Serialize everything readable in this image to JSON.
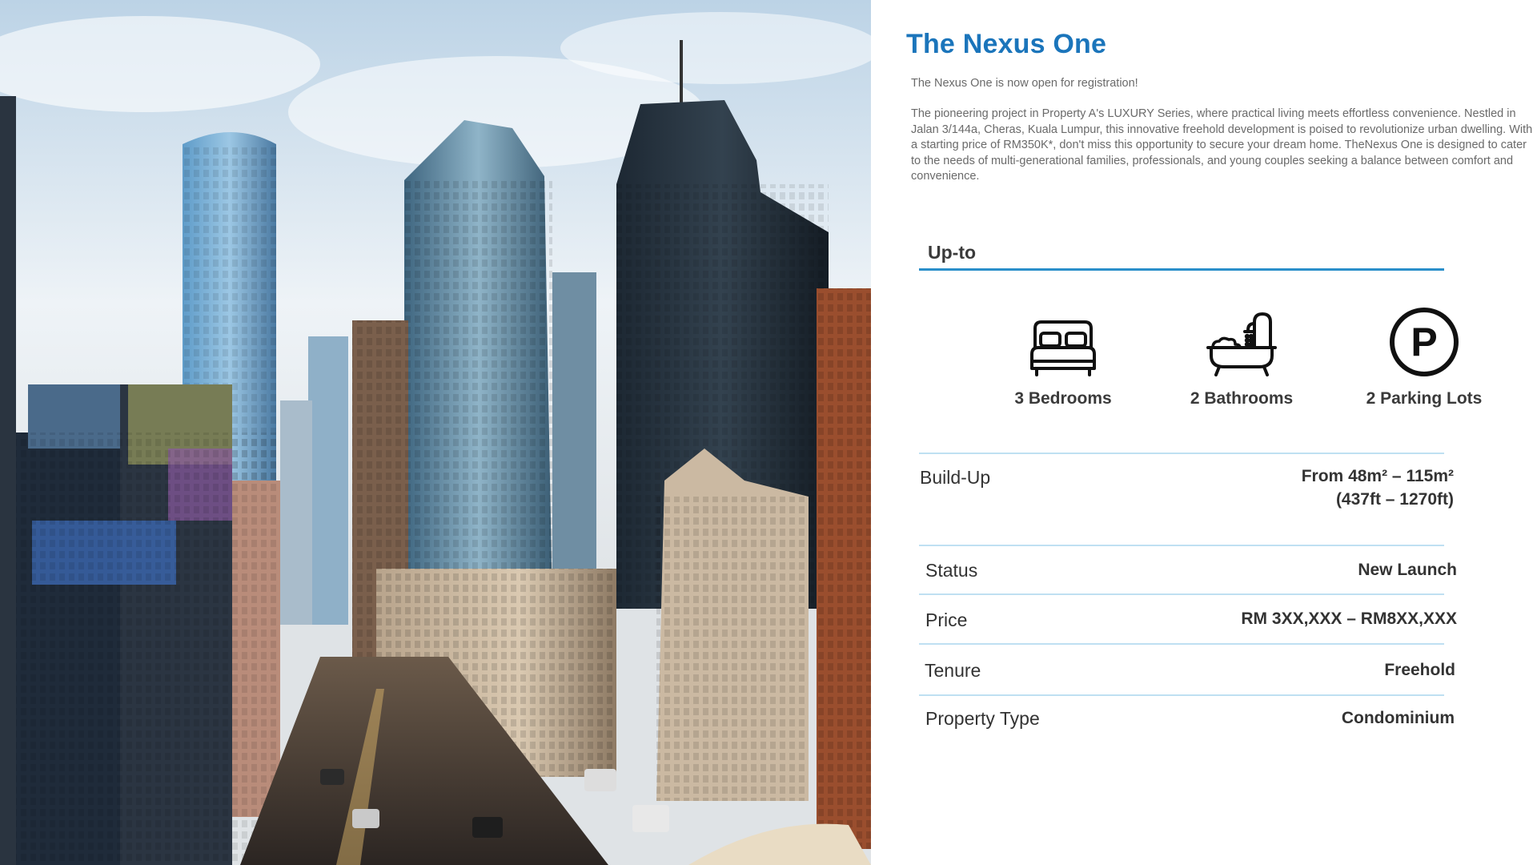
{
  "title": "The Nexus One",
  "intro": "The Nexus One is now open for registration!",
  "description": "The pioneering project in Property A's LUXURY Series, where practical living meets effortless convenience. Nestled in Jalan 3/144a, Cheras, Kuala Lumpur, this innovative freehold development is poised to revolutionize urban dwelling. With a starting price of RM350K*, don't miss this opportunity to secure your dream home. TheNexus One is designed to cater to the needs of multi-generational families, professionals, and young couples seeking a balance between comfort and convenience.",
  "upto": {
    "label": "Up-to",
    "features": [
      {
        "icon": "bed-icon",
        "label": "3 Bedrooms"
      },
      {
        "icon": "bathtub-icon",
        "label": "2 Bathrooms"
      },
      {
        "icon": "parking-icon",
        "label": "2 Parking Lots"
      }
    ]
  },
  "details": [
    {
      "label": "Build-Up",
      "value_line1": "From 48m² – 115m²",
      "value_line2": "(437ft – 1270ft)"
    },
    {
      "label": "Status",
      "value": "New Launch"
    },
    {
      "label": "Price",
      "value": "RM 3XX,XXX – RM8XX,XXX"
    },
    {
      "label": "Tenure",
      "value": "Freehold"
    },
    {
      "label": "Property Type",
      "value": "Condominium"
    }
  ],
  "colors": {
    "title": "#1b75bb",
    "accent_line": "#2a8fca",
    "separator": "#bfe0f2",
    "body_text": "#6a6a6a",
    "heading_text": "#3a3a3a"
  },
  "image": {
    "icon": "city-skyline-photo"
  }
}
